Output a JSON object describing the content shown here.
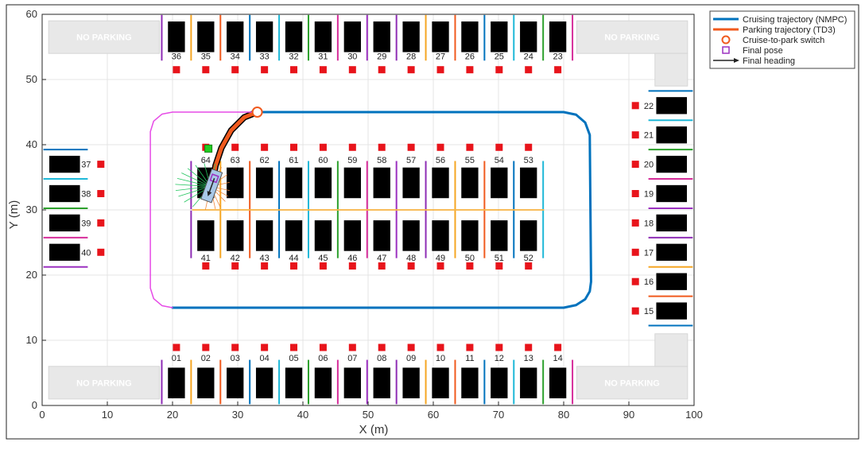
{
  "chart_data": {
    "type": "scatter",
    "title": "",
    "xlabel": "X (m)",
    "ylabel": "Y (m)",
    "xlim": [
      0,
      100
    ],
    "ylim": [
      0,
      60
    ],
    "grid": true,
    "legend_position": "outside-top-right",
    "x_ticks": [
      0,
      10,
      20,
      30,
      40,
      50,
      60,
      70,
      80,
      90,
      100
    ],
    "y_ticks": [
      0,
      10,
      20,
      30,
      40,
      50,
      60
    ],
    "no_parking_label": "NO PARKING",
    "no_parking_zones": [
      {
        "x": 1,
        "y": 54,
        "w": 17,
        "h": 5
      },
      {
        "x": 1,
        "y": 1,
        "w": 17,
        "h": 5
      },
      {
        "x": 82,
        "y": 1,
        "w": 17,
        "h": 5
      },
      {
        "x": 82,
        "y": 54,
        "w": 17,
        "h": 5
      }
    ],
    "legend": [
      {
        "label": "Cruising trajectory (NMPC)",
        "symbol": "line",
        "color": "#0072BD"
      },
      {
        "label": "Parking trajectory (TD3)",
        "symbol": "line",
        "color": "#F05A1E"
      },
      {
        "label": "Cruise-to-park switch",
        "symbol": "circle",
        "color": "#F05A1E"
      },
      {
        "label": "Final pose",
        "symbol": "square",
        "color": "#9B30C0"
      },
      {
        "label": "Final heading",
        "symbol": "arrow",
        "color": "#222222"
      }
    ],
    "series": [
      {
        "name": "Cruising trajectory (NMPC)",
        "color": "#0072BD",
        "x": [
          33,
          80,
          81.9,
          83.3,
          84,
          84.2,
          84,
          83.3,
          81.9,
          80,
          20
        ],
        "y": [
          45,
          45,
          44.6,
          43.4,
          41.5,
          19,
          17.5,
          16.3,
          15.4,
          15,
          15
        ]
      },
      {
        "name": "Parking trajectory (TD3)",
        "color": "#F05A1E",
        "x": [
          33,
          31,
          29,
          27.5,
          26.6,
          26.2,
          26.1
        ],
        "y": [
          45,
          44.2,
          42.2,
          39.5,
          36.8,
          34.5,
          33.6
        ]
      },
      {
        "name": "Loop path",
        "color": "#E64BE6",
        "x": [
          33,
          20,
          18.4,
          17.1,
          16.6,
          16.6,
          17.1,
          18.4,
          20
        ],
        "y": [
          45,
          45,
          44.7,
          43.6,
          42,
          18,
          16.4,
          15.3,
          15
        ]
      }
    ],
    "switch_point": {
      "x": 33,
      "y": 45
    },
    "target_marker": {
      "x": 25.5,
      "y": 39.4,
      "color": "#22CC22"
    },
    "final_pose": {
      "x": 26,
      "y": 33.7,
      "heading_deg": -100
    },
    "lidar_rays": {
      "origin": [
        25.8,
        33.6
      ],
      "angles": [
        100,
        115,
        130,
        145,
        160,
        175,
        190,
        205,
        222,
        240,
        262,
        285,
        300,
        320,
        335,
        350,
        10,
        30,
        55,
        75
      ],
      "length": 6
    },
    "waypoints_top": [
      [
        20.6,
        51.5
      ],
      [
        25.1,
        51.5
      ],
      [
        29.6,
        51.5
      ],
      [
        34.1,
        51.5
      ],
      [
        38.6,
        51.5
      ],
      [
        43.1,
        51.5
      ],
      [
        47.6,
        51.5
      ],
      [
        52.1,
        51.5
      ],
      [
        56.6,
        51.5
      ],
      [
        61.1,
        51.5
      ],
      [
        65.6,
        51.5
      ],
      [
        70.1,
        51.5
      ],
      [
        74.6,
        51.5
      ],
      [
        79.1,
        51.5
      ]
    ],
    "waypoints_bottom": [
      [
        20.6,
        8.9
      ],
      [
        25.1,
        8.9
      ],
      [
        29.6,
        8.9
      ],
      [
        34.1,
        8.9
      ],
      [
        38.6,
        8.9
      ],
      [
        43.1,
        8.9
      ],
      [
        47.6,
        8.9
      ],
      [
        52.1,
        8.9
      ],
      [
        56.6,
        8.9
      ],
      [
        61.1,
        8.9
      ],
      [
        65.6,
        8.9
      ],
      [
        70.1,
        8.9
      ],
      [
        74.6,
        8.9
      ],
      [
        79.1,
        8.9
      ]
    ],
    "waypoints_center_top": [
      [
        25.1,
        39.6
      ],
      [
        29.6,
        39.6
      ],
      [
        34.1,
        39.6
      ],
      [
        38.6,
        39.6
      ],
      [
        43.1,
        39.6
      ],
      [
        47.6,
        39.6
      ],
      [
        52.1,
        39.6
      ],
      [
        56.6,
        39.6
      ],
      [
        61.1,
        39.6
      ],
      [
        65.6,
        39.6
      ],
      [
        70.1,
        39.6
      ],
      [
        74.6,
        39.6
      ]
    ],
    "waypoints_center_bottom": [
      [
        25.1,
        21.4
      ],
      [
        29.6,
        21.4
      ],
      [
        34.1,
        21.4
      ],
      [
        38.6,
        21.4
      ],
      [
        43.1,
        21.4
      ],
      [
        47.6,
        21.4
      ],
      [
        52.1,
        21.4
      ],
      [
        56.6,
        21.4
      ],
      [
        61.1,
        21.4
      ],
      [
        65.6,
        21.4
      ],
      [
        70.1,
        21.4
      ],
      [
        74.6,
        21.4
      ]
    ],
    "waypoints_left": [
      [
        9,
        37
      ],
      [
        9,
        32.5
      ],
      [
        9,
        28
      ],
      [
        9,
        23.5
      ]
    ],
    "waypoints_right": [
      [
        91,
        46
      ],
      [
        91,
        41.5
      ],
      [
        91,
        37
      ],
      [
        91,
        32.5
      ],
      [
        91,
        28
      ],
      [
        91,
        23.5
      ],
      [
        91,
        19
      ],
      [
        91,
        14.5
      ]
    ],
    "spots_top": [
      {
        "id": "36",
        "x": 20.6
      },
      {
        "id": "35",
        "x": 25.1
      },
      {
        "id": "34",
        "x": 29.6
      },
      {
        "id": "33",
        "x": 34.1
      },
      {
        "id": "32",
        "x": 38.6
      },
      {
        "id": "31",
        "x": 43.1
      },
      {
        "id": "30",
        "x": 47.6
      },
      {
        "id": "29",
        "x": 52.1
      },
      {
        "id": "28",
        "x": 56.6
      },
      {
        "id": "27",
        "x": 61.1
      },
      {
        "id": "26",
        "x": 65.6
      },
      {
        "id": "25",
        "x": 70.1
      },
      {
        "id": "24",
        "x": 74.6
      },
      {
        "id": "23",
        "x": 79.1
      }
    ],
    "spots_bottom": [
      {
        "id": "01",
        "x": 20.6
      },
      {
        "id": "02",
        "x": 25.1
      },
      {
        "id": "03",
        "x": 29.6
      },
      {
        "id": "04",
        "x": 34.1
      },
      {
        "id": "05",
        "x": 38.6
      },
      {
        "id": "06",
        "x": 43.1
      },
      {
        "id": "07",
        "x": 47.6
      },
      {
        "id": "08",
        "x": 52.1
      },
      {
        "id": "09",
        "x": 56.6
      },
      {
        "id": "10",
        "x": 61.1
      },
      {
        "id": "11",
        "x": 65.6
      },
      {
        "id": "12",
        "x": 70.1
      },
      {
        "id": "13",
        "x": 74.6
      },
      {
        "id": "14",
        "x": 79.1
      }
    ],
    "spots_center_top": [
      {
        "id": "64",
        "x": 25.1
      },
      {
        "id": "63",
        "x": 29.6
      },
      {
        "id": "62",
        "x": 34.1
      },
      {
        "id": "61",
        "x": 38.6
      },
      {
        "id": "60",
        "x": 43.1
      },
      {
        "id": "59",
        "x": 47.6
      },
      {
        "id": "58",
        "x": 52.1
      },
      {
        "id": "57",
        "x": 56.6
      },
      {
        "id": "56",
        "x": 61.1
      },
      {
        "id": "55",
        "x": 65.6
      },
      {
        "id": "54",
        "x": 70.1
      },
      {
        "id": "53",
        "x": 74.6
      }
    ],
    "spots_center_bottom": [
      {
        "id": "41",
        "x": 25.1
      },
      {
        "id": "42",
        "x": 29.6
      },
      {
        "id": "43",
        "x": 34.1
      },
      {
        "id": "44",
        "x": 38.6
      },
      {
        "id": "45",
        "x": 43.1
      },
      {
        "id": "46",
        "x": 47.6
      },
      {
        "id": "47",
        "x": 52.1
      },
      {
        "id": "48",
        "x": 56.6
      },
      {
        "id": "49",
        "x": 61.1
      },
      {
        "id": "50",
        "x": 65.6
      },
      {
        "id": "51",
        "x": 70.1
      },
      {
        "id": "52",
        "x": 74.6
      }
    ],
    "spots_left": [
      {
        "id": "37",
        "y": 37
      },
      {
        "id": "38",
        "y": 32.5
      },
      {
        "id": "39",
        "y": 28
      },
      {
        "id": "40",
        "y": 23.5
      }
    ],
    "spots_right": [
      {
        "id": "22",
        "y": 46
      },
      {
        "id": "21",
        "y": 41.5
      },
      {
        "id": "20",
        "y": 37
      },
      {
        "id": "19",
        "y": 32.5
      },
      {
        "id": "18",
        "y": 28
      },
      {
        "id": "17",
        "y": 23.5
      },
      {
        "id": "16",
        "y": 19
      },
      {
        "id": "15",
        "y": 14.5
      }
    ],
    "divider_palette": [
      "#8E2DB5",
      "#F5A623",
      "#F05A1E",
      "#0072BD",
      "#1EB8D8",
      "#2CA02C",
      "#D62D9A",
      "#9B30C0"
    ]
  }
}
